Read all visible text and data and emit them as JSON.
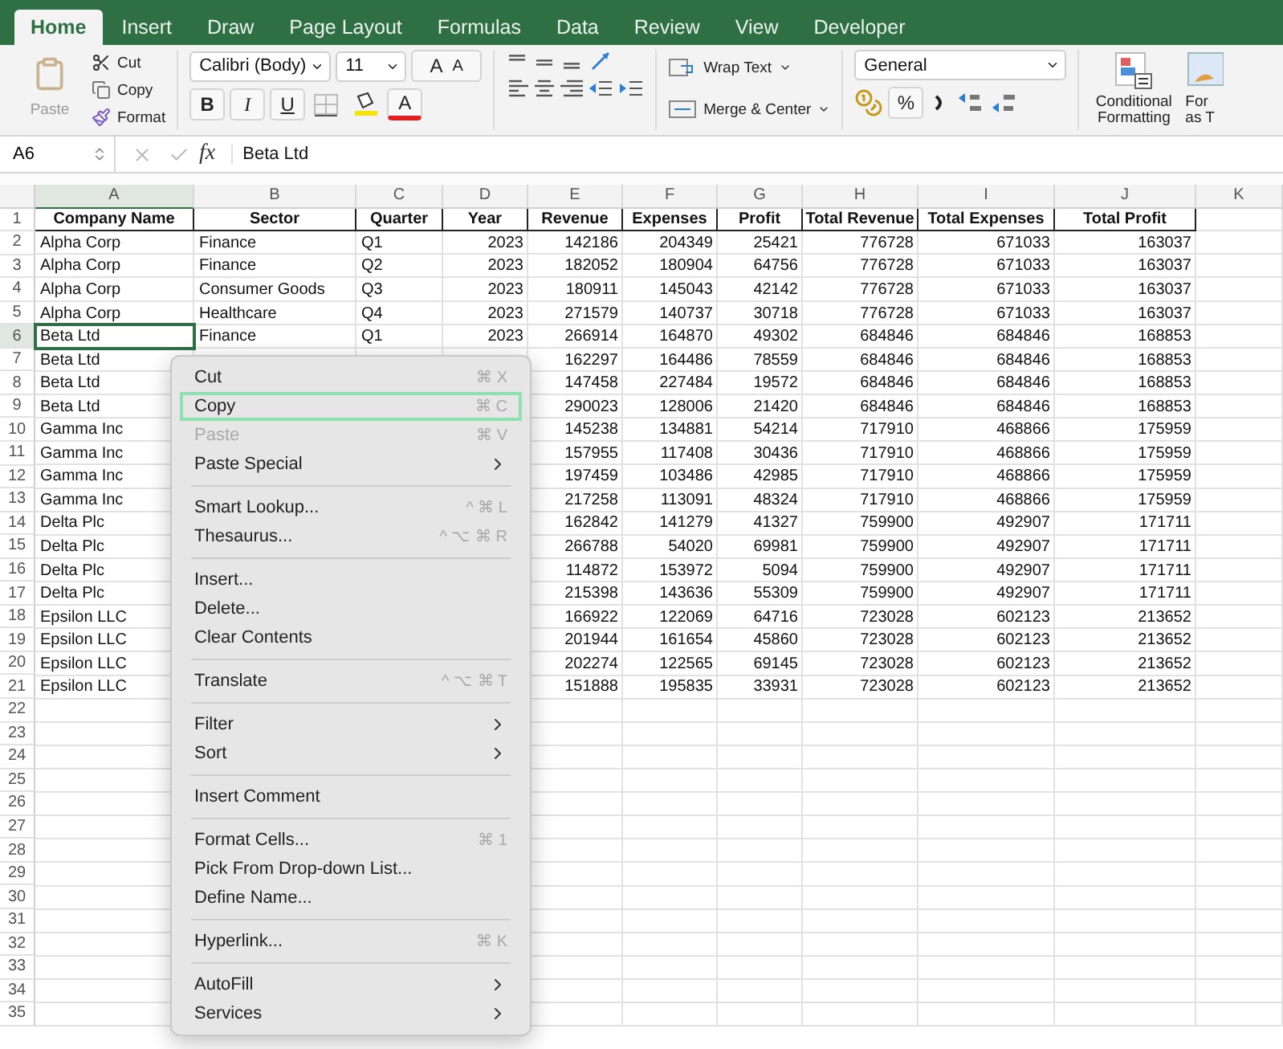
{
  "tabs": [
    {
      "label": "Home",
      "selected": true
    },
    {
      "label": "Insert",
      "selected": false
    },
    {
      "label": "Draw",
      "selected": false
    },
    {
      "label": "Page Layout",
      "selected": false
    },
    {
      "label": "Formulas",
      "selected": false
    },
    {
      "label": "Data",
      "selected": false
    },
    {
      "label": "Review",
      "selected": false
    },
    {
      "label": "View",
      "selected": false
    },
    {
      "label": "Developer",
      "selected": false
    }
  ],
  "clipboard": {
    "paste": "Paste",
    "cut": "Cut",
    "copy": "Copy",
    "format": "Format"
  },
  "font": {
    "name": "Calibri (Body)",
    "size": "11",
    "grow": "A",
    "shrink": "A",
    "bold": "B",
    "italic": "I",
    "underline": "U",
    "font_color_button": "A"
  },
  "alignment": {
    "wrap_text": "Wrap Text",
    "merge": "Merge & Center"
  },
  "number": {
    "format": "General",
    "percent": "%"
  },
  "styles": {
    "conditional": "Conditional Formatting",
    "format_as_table": "For as T"
  },
  "formula_bar": {
    "name_box": "A6",
    "fx": "fx",
    "value": "Beta Ltd"
  },
  "columns": [
    {
      "letter": "A",
      "selected": true
    },
    {
      "letter": "B",
      "selected": false
    },
    {
      "letter": "C",
      "selected": false
    },
    {
      "letter": "D",
      "selected": false
    },
    {
      "letter": "E",
      "selected": false
    },
    {
      "letter": "F",
      "selected": false
    },
    {
      "letter": "G",
      "selected": false
    },
    {
      "letter": "H",
      "selected": false
    },
    {
      "letter": "I",
      "selected": false
    },
    {
      "letter": "J",
      "selected": false
    },
    {
      "letter": "K",
      "selected": false
    }
  ],
  "rows": [
    {
      "n": "1",
      "kind": "header",
      "selected": false,
      "cells": [
        "Company Name",
        "Sector",
        "Quarter",
        "Year",
        "Revenue",
        "Expenses",
        "Profit",
        "Total Revenue",
        "Total Expenses",
        "Total Profit"
      ]
    },
    {
      "n": "2",
      "kind": "data",
      "selected": false,
      "cells": [
        "Alpha Corp",
        "Finance",
        "Q1",
        "2023",
        "142186",
        "204349",
        "25421",
        "776728",
        "671033",
        "163037"
      ]
    },
    {
      "n": "3",
      "kind": "data",
      "selected": false,
      "cells": [
        "Alpha Corp",
        "Finance",
        "Q2",
        "2023",
        "182052",
        "180904",
        "64756",
        "776728",
        "671033",
        "163037"
      ]
    },
    {
      "n": "4",
      "kind": "data",
      "selected": false,
      "cells": [
        "Alpha Corp",
        "Consumer Goods",
        "Q3",
        "2023",
        "180911",
        "145043",
        "42142",
        "776728",
        "671033",
        "163037"
      ]
    },
    {
      "n": "5",
      "kind": "data",
      "selected": false,
      "cells": [
        "Alpha Corp",
        "Healthcare",
        "Q4",
        "2023",
        "271579",
        "140737",
        "30718",
        "776728",
        "671033",
        "163037"
      ]
    },
    {
      "n": "6",
      "kind": "data",
      "selected": true,
      "cells": [
        "Beta Ltd",
        "Finance",
        "Q1",
        "2023",
        "266914",
        "164870",
        "49302",
        "684846",
        "684846",
        "168853"
      ]
    },
    {
      "n": "7",
      "kind": "data",
      "selected": false,
      "cells": [
        "Beta Ltd",
        null,
        null,
        null,
        "162297",
        "164486",
        "78559",
        "684846",
        "684846",
        "168853"
      ]
    },
    {
      "n": "8",
      "kind": "data",
      "selected": false,
      "cells": [
        "Beta Ltd",
        null,
        null,
        null,
        "147458",
        "227484",
        "19572",
        "684846",
        "684846",
        "168853"
      ]
    },
    {
      "n": "9",
      "kind": "data",
      "selected": false,
      "cells": [
        "Beta Ltd",
        null,
        null,
        null,
        "290023",
        "128006",
        "21420",
        "684846",
        "684846",
        "168853"
      ]
    },
    {
      "n": "10",
      "kind": "data",
      "selected": false,
      "cells": [
        "Gamma Inc",
        null,
        null,
        null,
        "145238",
        "134881",
        "54214",
        "717910",
        "468866",
        "175959"
      ]
    },
    {
      "n": "11",
      "kind": "data",
      "selected": false,
      "cells": [
        "Gamma Inc",
        null,
        null,
        null,
        "157955",
        "117408",
        "30436",
        "717910",
        "468866",
        "175959"
      ]
    },
    {
      "n": "12",
      "kind": "data",
      "selected": false,
      "cells": [
        "Gamma Inc",
        null,
        null,
        null,
        "197459",
        "103486",
        "42985",
        "717910",
        "468866",
        "175959"
      ]
    },
    {
      "n": "13",
      "kind": "data",
      "selected": false,
      "cells": [
        "Gamma Inc",
        null,
        null,
        null,
        "217258",
        "113091",
        "48324",
        "717910",
        "468866",
        "175959"
      ]
    },
    {
      "n": "14",
      "kind": "data",
      "selected": false,
      "cells": [
        "Delta Plc",
        null,
        null,
        null,
        "162842",
        "141279",
        "41327",
        "759900",
        "492907",
        "171711"
      ]
    },
    {
      "n": "15",
      "kind": "data",
      "selected": false,
      "cells": [
        "Delta Plc",
        null,
        null,
        null,
        "266788",
        "54020",
        "69981",
        "759900",
        "492907",
        "171711"
      ]
    },
    {
      "n": "16",
      "kind": "data",
      "selected": false,
      "cells": [
        "Delta Plc",
        null,
        null,
        null,
        "114872",
        "153972",
        "5094",
        "759900",
        "492907",
        "171711"
      ]
    },
    {
      "n": "17",
      "kind": "data",
      "selected": false,
      "cells": [
        "Delta Plc",
        null,
        null,
        null,
        "215398",
        "143636",
        "55309",
        "759900",
        "492907",
        "171711"
      ]
    },
    {
      "n": "18",
      "kind": "data",
      "selected": false,
      "cells": [
        "Epsilon LLC",
        null,
        null,
        null,
        "166922",
        "122069",
        "64716",
        "723028",
        "602123",
        "213652"
      ]
    },
    {
      "n": "19",
      "kind": "data",
      "selected": false,
      "cells": [
        "Epsilon LLC",
        null,
        null,
        null,
        "201944",
        "161654",
        "45860",
        "723028",
        "602123",
        "213652"
      ]
    },
    {
      "n": "20",
      "kind": "data",
      "selected": false,
      "cells": [
        "Epsilon LLC",
        null,
        null,
        null,
        "202274",
        "122565",
        "69145",
        "723028",
        "602123",
        "213652"
      ]
    },
    {
      "n": "21",
      "kind": "data",
      "selected": false,
      "cells": [
        "Epsilon LLC",
        null,
        null,
        null,
        "151888",
        "195835",
        "33931",
        "723028",
        "602123",
        "213652"
      ]
    },
    {
      "n": "22",
      "kind": "data",
      "selected": false,
      "cells": []
    },
    {
      "n": "23",
      "kind": "data",
      "selected": false,
      "cells": []
    },
    {
      "n": "24",
      "kind": "data",
      "selected": false,
      "cells": []
    },
    {
      "n": "25",
      "kind": "data",
      "selected": false,
      "cells": []
    },
    {
      "n": "26",
      "kind": "data",
      "selected": false,
      "cells": []
    },
    {
      "n": "27",
      "kind": "data",
      "selected": false,
      "cells": []
    },
    {
      "n": "28",
      "kind": "data",
      "selected": false,
      "cells": []
    },
    {
      "n": "29",
      "kind": "data",
      "selected": false,
      "cells": []
    },
    {
      "n": "30",
      "kind": "data",
      "selected": false,
      "cells": []
    },
    {
      "n": "31",
      "kind": "data",
      "selected": false,
      "cells": []
    },
    {
      "n": "32",
      "kind": "data",
      "selected": false,
      "cells": []
    },
    {
      "n": "33",
      "kind": "data",
      "selected": false,
      "cells": []
    },
    {
      "n": "34",
      "kind": "data",
      "selected": false,
      "cells": []
    },
    {
      "n": "35",
      "kind": "data",
      "selected": false,
      "cells": []
    }
  ],
  "context_menu": {
    "items": [
      {
        "kind": "item",
        "label": "Cut",
        "shortcut": "⌘ X",
        "submenu": false,
        "disabled": false,
        "selected": false
      },
      {
        "kind": "item",
        "label": "Copy",
        "shortcut": "⌘ C",
        "submenu": false,
        "disabled": false,
        "selected": true
      },
      {
        "kind": "item",
        "label": "Paste",
        "shortcut": "⌘ V",
        "submenu": false,
        "disabled": true,
        "selected": false
      },
      {
        "kind": "item",
        "label": "Paste Special",
        "submenu": true,
        "disabled": false,
        "selected": false
      },
      {
        "kind": "separator"
      },
      {
        "kind": "item",
        "label": "Smart Lookup...",
        "shortcut": "^ ⌘ L",
        "submenu": false,
        "disabled": false,
        "selected": false
      },
      {
        "kind": "item",
        "label": "Thesaurus...",
        "shortcut": "^ ⌥ ⌘ R",
        "submenu": false,
        "disabled": false,
        "selected": false
      },
      {
        "kind": "separator"
      },
      {
        "kind": "item",
        "label": "Insert...",
        "submenu": false,
        "disabled": false,
        "selected": false
      },
      {
        "kind": "item",
        "label": "Delete...",
        "submenu": false,
        "disabled": false,
        "selected": false
      },
      {
        "kind": "item",
        "label": "Clear Contents",
        "submenu": false,
        "disabled": false,
        "selected": false
      },
      {
        "kind": "separator"
      },
      {
        "kind": "item",
        "label": "Translate",
        "shortcut": "^ ⌥ ⌘ T",
        "submenu": false,
        "disabled": false,
        "selected": false
      },
      {
        "kind": "separator"
      },
      {
        "kind": "item",
        "label": "Filter",
        "submenu": true,
        "disabled": false,
        "selected": false
      },
      {
        "kind": "item",
        "label": "Sort",
        "submenu": true,
        "disabled": false,
        "selected": false
      },
      {
        "kind": "separator"
      },
      {
        "kind": "item",
        "label": "Insert Comment",
        "submenu": false,
        "disabled": false,
        "selected": false
      },
      {
        "kind": "separator"
      },
      {
        "kind": "item",
        "label": "Format Cells...",
        "shortcut": "⌘ 1",
        "submenu": false,
        "disabled": false,
        "selected": false
      },
      {
        "kind": "item",
        "label": "Pick From Drop-down List...",
        "submenu": false,
        "disabled": false,
        "selected": false
      },
      {
        "kind": "item",
        "label": "Define Name...",
        "submenu": false,
        "disabled": false,
        "selected": false
      },
      {
        "kind": "separator"
      },
      {
        "kind": "item",
        "label": "Hyperlink...",
        "shortcut": "⌘ K",
        "submenu": false,
        "disabled": false,
        "selected": false
      },
      {
        "kind": "separator"
      },
      {
        "kind": "item",
        "label": "AutoFill",
        "submenu": true,
        "disabled": false,
        "selected": false
      },
      {
        "kind": "item",
        "label": "Services",
        "submenu": true,
        "disabled": false,
        "selected": false
      }
    ]
  }
}
